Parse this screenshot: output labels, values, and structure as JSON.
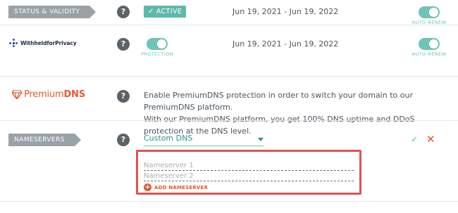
{
  "status_row": {
    "label": "STATUS & VALIDITY",
    "help": "?",
    "status_badge": "ACTIVE",
    "dates": "Jun 19, 2021 - Jun 19, 2022",
    "auto_renew_label": "AUTO-RENEW",
    "auto_renew_on": true
  },
  "privacy_row": {
    "logo_text": "WithheldforPrivacy",
    "help": "?",
    "protection_label": "PROTECTION",
    "protection_on": true,
    "dates": "Jun 19, 2021 - Jun 19, 2022",
    "auto_renew_label": "AUTO-RENEW",
    "auto_renew_on": true
  },
  "premiumdns_row": {
    "logo_text_prefix": "Premium",
    "logo_text_suffix": "DNS",
    "help": "?",
    "description_line1": "Enable PremiumDNS protection in order to switch your domain to our PremiumDNS platform.",
    "description_line2": "With our PremiumDNS platform, you get 100% DNS uptime and DDoS protection at the DNS level."
  },
  "nameservers_row": {
    "label": "NAMESERVERS",
    "help": "?",
    "dns_select_value": "Custom DNS",
    "confirm_icon": "check-icon",
    "cancel_icon": "close-icon",
    "nameserver_1_placeholder": "Nameserver 1",
    "nameserver_2_placeholder": "Nameserver 2",
    "add_nameserver_label": "ADD NAMESERVER"
  },
  "colors": {
    "teal_accent": "#6ec4b5",
    "highlight_border": "#e05252",
    "brand_orange": "#e05a2b"
  }
}
